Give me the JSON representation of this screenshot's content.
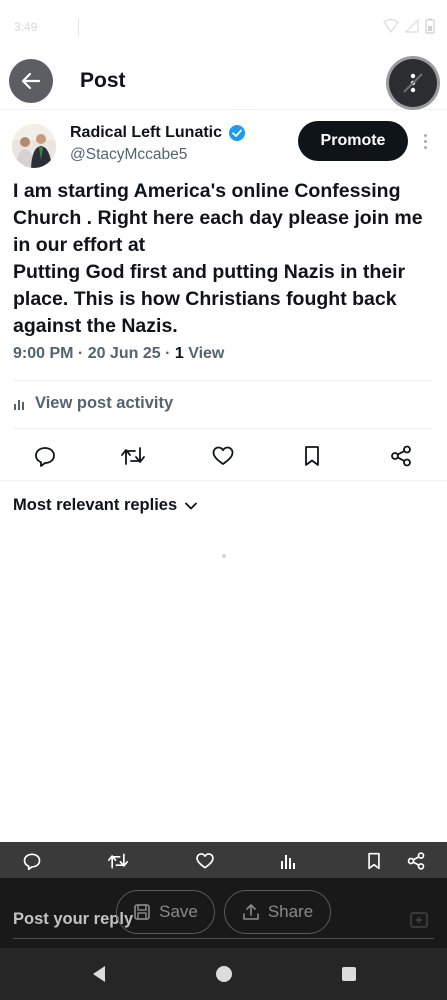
{
  "status_bar": {
    "time": "3:49"
  },
  "header": {
    "title": "Post"
  },
  "post": {
    "author_name": "Radical Left Lunatic",
    "author_handle": "@StacyMccabe5",
    "promote_label": "Promote",
    "text": "I am starting America's online Confessing Church . Right here each day please join me in our effort at\nPutting God first and putting Nazis in their place. This is how Christians fought back against the Nazis.",
    "time_date": "9:00 PM · 20 Jun 25 · ",
    "views_count": "1",
    "views_label": " View",
    "activity_label": "View post activity"
  },
  "replies": {
    "filter_label": "Most relevant replies"
  },
  "reply_bar": {
    "placeholder": "Post your reply",
    "save_label": "Save",
    "share_label": "Share"
  },
  "icons": {
    "back": "arrow-left-icon",
    "more": "more-vertical-icon",
    "verified": "verified-badge-icon",
    "reply": "reply-icon",
    "repost": "repost-icon",
    "like": "heart-icon",
    "bookmark": "bookmark-icon",
    "share": "share-icon",
    "views": "bar-chart-icon"
  },
  "colors": {
    "accent": "#1d9bf0",
    "text": "#0f1419",
    "muted": "#536471",
    "button_dark": "#0f1419"
  }
}
